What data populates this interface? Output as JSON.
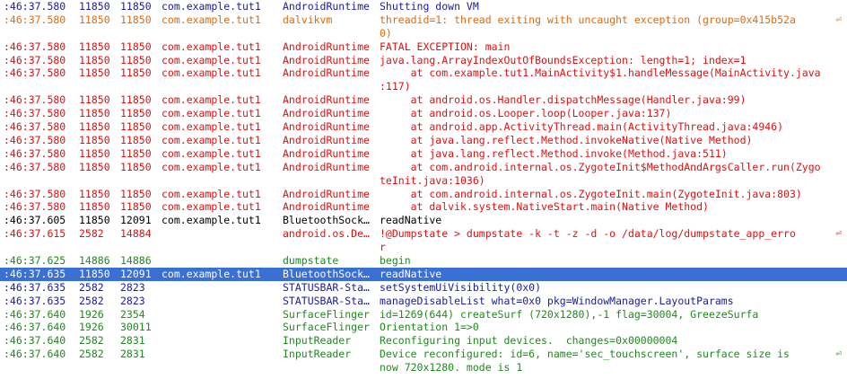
{
  "colors": {
    "verbose": "#1a1aa6",
    "warning": "#e06a10",
    "error": "#e01010",
    "debug": "#000000",
    "info": "#1e8a1e",
    "selection": "#3a6fd4"
  },
  "wrap_icon": "line-wrap-icon",
  "rows": [
    {
      "time": ":46:37.580",
      "pid": "11850",
      "tid": "11850",
      "app": "com.example.tut1",
      "tag": "AndroidRuntime",
      "msg": "Shutting down VM",
      "level": "blue"
    },
    {
      "time": ":46:37.580",
      "pid": "11850",
      "tid": "11850",
      "app": "com.example.tut1",
      "tag": "dalvikvm",
      "msg": "threadid=1: thread exiting with uncaught exception (group=0x415b52a",
      "msg2": "0)",
      "wrap": "⏎",
      "level": "orange"
    },
    {
      "time": ":46:37.580",
      "pid": "11850",
      "tid": "11850",
      "app": "com.example.tut1",
      "tag": "AndroidRuntime",
      "msg": "FATAL EXCEPTION: main",
      "level": "red"
    },
    {
      "time": ":46:37.580",
      "pid": "11850",
      "tid": "11850",
      "app": "com.example.tut1",
      "tag": "AndroidRuntime",
      "msg": "java.lang.ArrayIndexOutOfBoundsException: length=1; index=1",
      "level": "red"
    },
    {
      "time": ":46:37.580",
      "pid": "11850",
      "tid": "11850",
      "app": "com.example.tut1",
      "tag": "AndroidRuntime",
      "msg": "     at com.example.tut1.MainActivity$1.handleMessage(MainActivity.java",
      "msg2": ":117)",
      "level": "red"
    },
    {
      "time": ":46:37.580",
      "pid": "11850",
      "tid": "11850",
      "app": "com.example.tut1",
      "tag": "AndroidRuntime",
      "msg": "     at android.os.Handler.dispatchMessage(Handler.java:99)",
      "level": "red"
    },
    {
      "time": ":46:37.580",
      "pid": "11850",
      "tid": "11850",
      "app": "com.example.tut1",
      "tag": "AndroidRuntime",
      "msg": "     at android.os.Looper.loop(Looper.java:137)",
      "level": "red"
    },
    {
      "time": ":46:37.580",
      "pid": "11850",
      "tid": "11850",
      "app": "com.example.tut1",
      "tag": "AndroidRuntime",
      "msg": "     at android.app.ActivityThread.main(ActivityThread.java:4946)",
      "level": "red"
    },
    {
      "time": ":46:37.580",
      "pid": "11850",
      "tid": "11850",
      "app": "com.example.tut1",
      "tag": "AndroidRuntime",
      "msg": "     at java.lang.reflect.Method.invokeNative(Native Method)",
      "level": "red"
    },
    {
      "time": ":46:37.580",
      "pid": "11850",
      "tid": "11850",
      "app": "com.example.tut1",
      "tag": "AndroidRuntime",
      "msg": "     at java.lang.reflect.Method.invoke(Method.java:511)",
      "level": "red"
    },
    {
      "time": ":46:37.580",
      "pid": "11850",
      "tid": "11850",
      "app": "com.example.tut1",
      "tag": "AndroidRuntime",
      "msg": "     at com.android.internal.os.ZygoteInit$MethodAndArgsCaller.run(Zygo",
      "msg2": "teInit.java:1036)",
      "level": "red"
    },
    {
      "time": ":46:37.580",
      "pid": "11850",
      "tid": "11850",
      "app": "com.example.tut1",
      "tag": "AndroidRuntime",
      "msg": "     at com.android.internal.os.ZygoteInit.main(ZygoteInit.java:803)",
      "level": "red"
    },
    {
      "time": ":46:37.580",
      "pid": "11850",
      "tid": "11850",
      "app": "com.example.tut1",
      "tag": "AndroidRuntime",
      "msg": "     at dalvik.system.NativeStart.main(Native Method)",
      "level": "red"
    },
    {
      "time": ":46:37.605",
      "pid": "11850",
      "tid": "12091",
      "app": "com.example.tut1",
      "tag": "BluetoothSock…",
      "msg": "readNative",
      "level": "black"
    },
    {
      "time": ":46:37.615",
      "pid": "2582",
      "tid": "14884",
      "app": "",
      "tag": "android.os.De…",
      "msg": "!@Dumpstate > dumpstate -k -t -z -d -o /data/log/dumpstate_app_erro",
      "msg2": "r",
      "wrap": "⏎",
      "level": "red"
    },
    {
      "time": ":46:37.625",
      "pid": "14886",
      "tid": "14886",
      "app": "",
      "tag": "dumpstate",
      "msg": "begin",
      "level": "green"
    },
    {
      "time": ":46:37.635",
      "pid": "11850",
      "tid": "12091",
      "app": "com.example.tut1",
      "tag": "BluetoothSock…",
      "msg": "readNative",
      "level": "black",
      "selected": true
    },
    {
      "time": ":46:37.635",
      "pid": "2582",
      "tid": "2823",
      "app": "",
      "tag": "STATUSBAR-Sta…",
      "msg": "setSystemUiVisibility(0x0)",
      "level": "blue"
    },
    {
      "time": ":46:37.635",
      "pid": "2582",
      "tid": "2823",
      "app": "",
      "tag": "STATUSBAR-Sta…",
      "msg": "manageDisableList what=0x0 pkg=WindowManager.LayoutParams",
      "level": "blue"
    },
    {
      "time": ":46:37.640",
      "pid": "1926",
      "tid": "2354",
      "app": "",
      "tag": "SurfaceFlinger",
      "msg": "id=1269(644) createSurf (720x1280),-1 flag=30004, GreezeSurfa",
      "level": "green"
    },
    {
      "time": ":46:37.640",
      "pid": "1926",
      "tid": "30011",
      "app": "",
      "tag": "SurfaceFlinger",
      "msg": "Orientation 1=>0",
      "level": "green"
    },
    {
      "time": ":46:37.640",
      "pid": "2582",
      "tid": "2831",
      "app": "",
      "tag": "InputReader",
      "msg": "Reconfiguring input devices.  changes=0x00000004",
      "level": "green"
    },
    {
      "time": ":46:37.640",
      "pid": "2582",
      "tid": "2831",
      "app": "",
      "tag": "InputReader",
      "msg": "Device reconfigured: id=6, name='sec_touchscreen', surface size is",
      "msg2": "now 720x1280. mode is 1",
      "wrap": "⏎",
      "level": "green"
    }
  ]
}
